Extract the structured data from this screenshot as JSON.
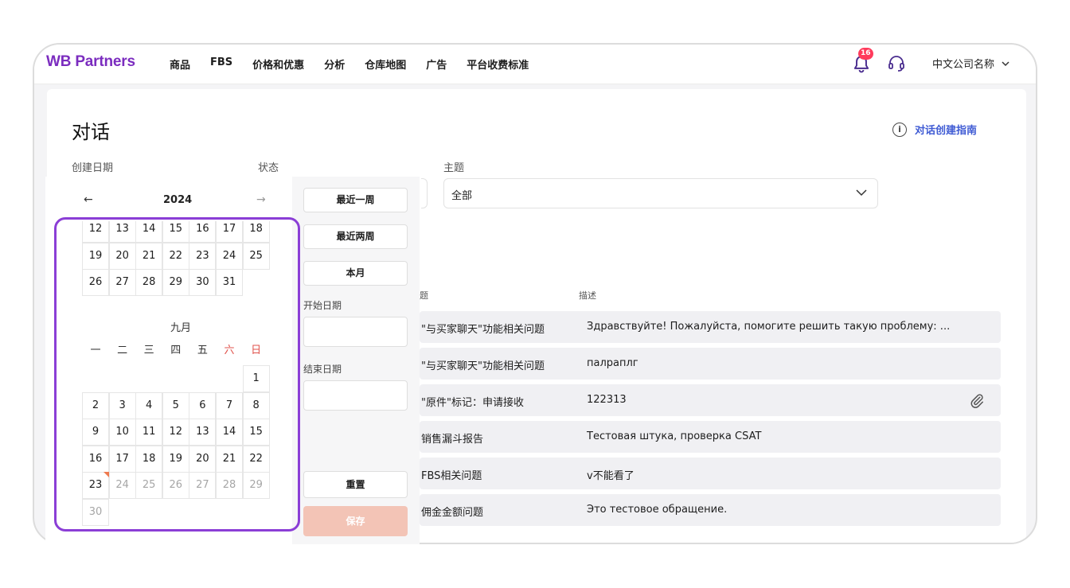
{
  "header": {
    "logo": "WB Partners",
    "nav": [
      "商品",
      "FBS",
      "价格和优惠",
      "分析",
      "仓库地图",
      "广告",
      "平台收费标准"
    ],
    "notifications_count": "16",
    "company": "中文公司名称"
  },
  "page": {
    "title": "对话",
    "guide_link": "对话创建指南",
    "filters": {
      "created_date_label": "创建日期",
      "status_label": "状态",
      "theme_label": "主题",
      "theme_value": "全部"
    },
    "table": {
      "col_theme": "题",
      "col_desc": "描述",
      "rows": [
        {
          "theme": "\"与买家聊天\"功能相关问题",
          "desc": "Здравствуйте! Пожалуйста, помогите решить такую проблему: ...",
          "attachment": false
        },
        {
          "theme": "\"与买家聊天\"功能相关问题",
          "desc": "палраплг",
          "attachment": false
        },
        {
          "theme": "\"原件\"标记：申请接收",
          "desc": "122313",
          "attachment": true
        },
        {
          "theme": "销售漏斗报告",
          "desc": "Тестовая штука, проверка CSAT",
          "attachment": false
        },
        {
          "theme": "FBS相关问题",
          "desc": "v不能看了",
          "attachment": false
        },
        {
          "theme": "佣金金额问题",
          "desc": "Это тестовое обращение.",
          "attachment": false
        }
      ]
    }
  },
  "datepicker": {
    "year": "2024",
    "presets": [
      "最近一周",
      "最近两周",
      "本月"
    ],
    "start_label": "开始日期",
    "end_label": "结束日期",
    "reset": "重置",
    "save": "保存",
    "august_rows": [
      [
        "12",
        "13",
        "14",
        "15",
        "16",
        "17",
        "18"
      ],
      [
        "19",
        "20",
        "21",
        "22",
        "23",
        "24",
        "25"
      ],
      [
        "26",
        "27",
        "28",
        "29",
        "30",
        "31",
        ""
      ]
    ],
    "september_title": "九月",
    "weekdays": [
      "一",
      "二",
      "三",
      "四",
      "五",
      "六",
      "日"
    ],
    "september_rows": [
      [
        "",
        "",
        "",
        "",
        "",
        "",
        "1"
      ],
      [
        "2",
        "3",
        "4",
        "5",
        "6",
        "7",
        "8"
      ],
      [
        "9",
        "10",
        "11",
        "12",
        "13",
        "14",
        "15"
      ],
      [
        "16",
        "17",
        "18",
        "19",
        "20",
        "21",
        "22"
      ],
      [
        "23",
        "24",
        "25",
        "26",
        "27",
        "28",
        "29"
      ],
      [
        "30",
        "",
        "",
        "",
        "",
        "",
        ""
      ]
    ],
    "today": "23",
    "colors": {
      "accent": "#8b3ed6",
      "weekend": "#e0524b",
      "today_marker": "#ee7a4f",
      "save_disabled": "#f3c4b6"
    }
  }
}
